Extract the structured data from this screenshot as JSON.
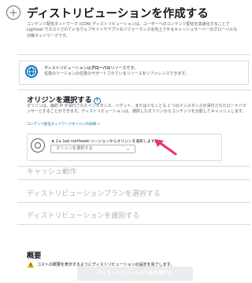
{
  "header": {
    "title": "ディストリビューションを作成する",
    "description": "コンテンツ配信ネットワーク (CDN) ディストリビューションは、ユーザーへのコンテンツ配信を高速化することで Lightsail でホストされているウェブサイトやアプリのパフォーマンスを向上させるキャッシュサーバーのグローバルな分散ネットワークです。"
  },
  "info_box": {
    "line1_prefix": "ディストリビューションは",
    "line1_bold": "グローバル",
    "line1_suffix": "リソースです。",
    "line2": "任意のリージョンの任意のサポートされているリソースをリファレンスできます。"
  },
  "origin_section": {
    "title": "オリジンを選択する",
    "help": "?",
    "description": "オリジンは、静的 IP が添付されたインスタンス、バケット、または少なくとも 1 つのインスタンスが添付されたロードバランサーとすることができます。ディストリビューションは、選択したオリジンからコンテンツを分配してキャッシュします。",
    "link": "コンテンツ配信ネットワークオリジンの詳細",
    "region_star": "★",
    "region_text": "★ 2 ▸ (sa) northeast-リージョンからオリジンを選択します。",
    "select_placeholder": "オリジンを選択する",
    "chevron": "⌄"
  },
  "sections": {
    "cache": "キャッシュ動作",
    "plan": "ディストリビューションプランを選択する",
    "identify": "ディストリビューションを識別する"
  },
  "summary": {
    "title": "概要",
    "message": "コストの概要を表示するようにディストリビューションの設定を完了します。"
  },
  "create_button": "ディストリビューションを作成する",
  "colors": {
    "link_blue": "#0073bb",
    "arrow_pink": "#e8336b",
    "warning_yellow": "#f2b422",
    "disabled_text": "#aab7b8"
  },
  "icons": {
    "header": "add-circle-icon",
    "info": "globe-icon",
    "origin": "origin-target-icon",
    "warning": "warning-icon"
  }
}
